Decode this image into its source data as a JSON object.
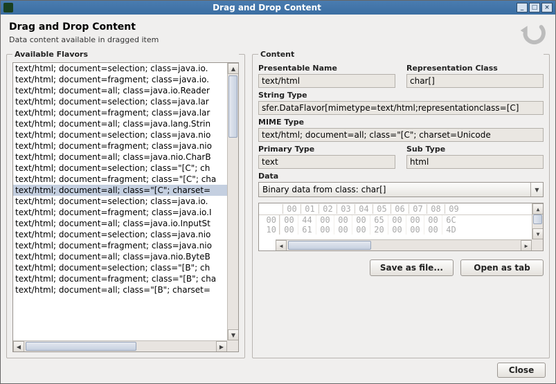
{
  "window": {
    "title": "Drag and Drop Content",
    "controls": {
      "min": "_",
      "max": "□",
      "close": "×"
    }
  },
  "header": {
    "title": "Drag and Drop Content",
    "subtitle": "Data content available in dragged item"
  },
  "left": {
    "legend": "Available Flavors",
    "items": [
      "text/html; document=selection; class=java.io.",
      "text/html; document=fragment; class=java.io.",
      "text/html; document=all; class=java.io.Reader",
      "text/html; document=selection; class=java.lar",
      "text/html; document=fragment; class=java.lar",
      "text/html; document=all; class=java.lang.Strin",
      "text/html; document=selection; class=java.nio",
      "text/html; document=fragment; class=java.nio",
      "text/html; document=all; class=java.nio.CharB",
      "text/html; document=selection; class=\"[C\"; ch",
      "text/html; document=fragment; class=\"[C\"; cha",
      "text/html; document=all; class=\"[C\"; charset=",
      "text/html; document=selection; class=java.io.",
      "text/html; document=fragment; class=java.io.I",
      "text/html; document=all; class=java.io.InputSt",
      "text/html; document=selection; class=java.nio",
      "text/html; document=fragment; class=java.nio",
      "text/html; document=all; class=java.nio.ByteB",
      "text/html; document=selection; class=\"[B\"; ch",
      "text/html; document=fragment; class=\"[B\"; cha",
      "text/html; document=all; class=\"[B\"; charset="
    ],
    "selected_index": 11
  },
  "right": {
    "legend": "Content",
    "labels": {
      "presentable_name": "Presentable Name",
      "representation_class": "Representation Class",
      "string_type": "String Type",
      "mime_type": "MIME Type",
      "primary_type": "Primary Type",
      "sub_type": "Sub Type",
      "data": "Data"
    },
    "values": {
      "presentable_name": "text/html",
      "representation_class": "char[]",
      "string_type": "sfer.DataFlavor[mimetype=text/html;representationclass=[C]",
      "mime_type": "text/html; document=all; class=\"[C\"; charset=Unicode",
      "primary_type": "text",
      "sub_type": "html"
    },
    "data_combo": "Binary data from class: char[]",
    "hex": {
      "headers": [
        "00",
        "01",
        "02",
        "03",
        "04",
        "05",
        "06",
        "07",
        "08",
        "09"
      ],
      "rows": [
        {
          "offset": "00",
          "cells": [
            "00",
            "44",
            "00",
            "00",
            "00",
            "65",
            "00",
            "00",
            "00",
            "6C"
          ]
        },
        {
          "offset": "10",
          "cells": [
            "00",
            "61",
            "00",
            "00",
            "00",
            "20",
            "00",
            "00",
            "00",
            "4D"
          ]
        }
      ]
    },
    "buttons": {
      "save": "Save as file...",
      "open": "Open as tab"
    }
  },
  "footer": {
    "close": "Close"
  }
}
